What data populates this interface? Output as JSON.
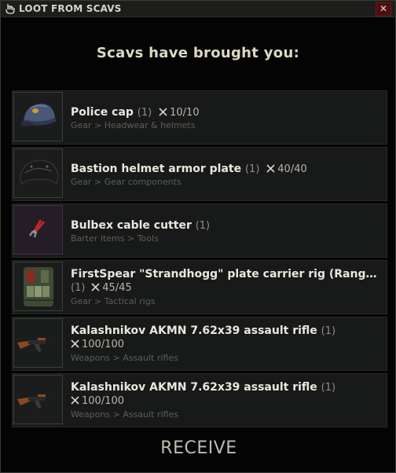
{
  "window": {
    "title": "LOOT FROM SCAVS",
    "close_label": "✕"
  },
  "heading": "Scavs have brought you:",
  "items": [
    {
      "name": "Police cap",
      "qty": "(1)",
      "durability": "10/10",
      "category": "Gear > Headwear & helmets",
      "icon": "police-cap-icon"
    },
    {
      "name": "Bastion helmet armor plate",
      "qty": "(1)",
      "durability": "40/40",
      "category": "Gear > Gear components",
      "icon": "armor-plate-icon"
    },
    {
      "name": "Bulbex cable cutter",
      "qty": "(1)",
      "durability": "",
      "category": "Barter items > Tools",
      "icon": "cable-cutter-icon"
    },
    {
      "name": "FirstSpear \"Strandhogg\" plate carrier rig (Range...",
      "qty": "(1)",
      "durability": "45/45",
      "category": "Gear > Tactical rigs",
      "icon": "plate-carrier-icon"
    },
    {
      "name": "Kalashnikov AKMN 7.62x39 assault rifle",
      "qty": "(1)",
      "durability": "100/100",
      "category": "Weapons > Assault rifles",
      "icon": "rifle-icon"
    },
    {
      "name": "Kalashnikov AKMN 7.62x39 assault rifle",
      "qty": "(1)",
      "durability": "100/100",
      "category": "Weapons > Assault rifles",
      "icon": "rifle-icon"
    }
  ],
  "receive_label": "RECEIVE"
}
